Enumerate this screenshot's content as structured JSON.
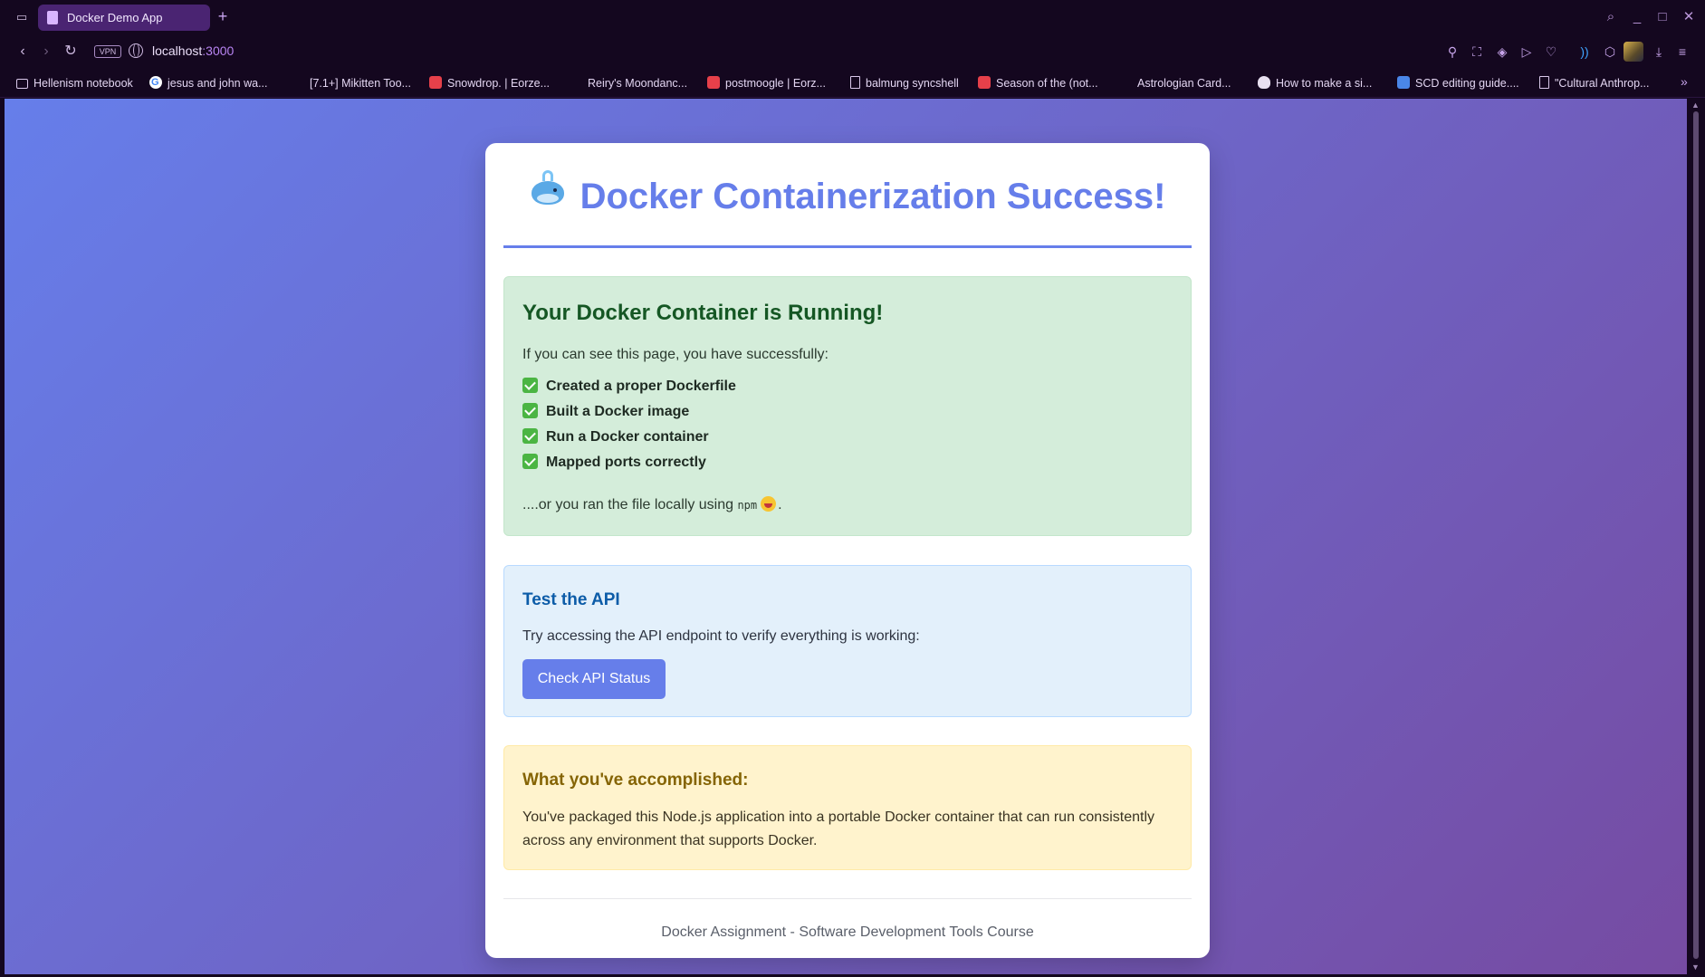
{
  "browser": {
    "tab_title": "Docker Demo App",
    "url_host": "localhost",
    "url_port": ":3000",
    "vpn_label": "VPN",
    "bookmarks": [
      {
        "label": "Hellenism notebook",
        "icon": "folder-icon"
      },
      {
        "label": "jesus and john wa...",
        "icon": "google-icon"
      },
      {
        "label": "[7.1+] Mikitten Too...",
        "icon": "none"
      },
      {
        "label": "Snowdrop. | Eorze...",
        "icon": "red-app-icon"
      },
      {
        "label": "Reiry's Moondanc...",
        "icon": "none"
      },
      {
        "label": "postmoogle | Eorz...",
        "icon": "red-app-icon"
      },
      {
        "label": "balmung syncshell",
        "icon": "document-icon"
      },
      {
        "label": "Season of the (not...",
        "icon": "red-app-icon"
      },
      {
        "label": "Astrologian Card...",
        "icon": "none"
      },
      {
        "label": "How to make a si...",
        "icon": "skull-icon"
      },
      {
        "label": "SCD editing guide....",
        "icon": "google-docs-icon"
      },
      {
        "label": "\"Cultural Anthrop...",
        "icon": "document-icon"
      }
    ]
  },
  "page": {
    "title": "Docker Containerization Success!",
    "title_icon": "whale-icon",
    "success": {
      "heading": "Your Docker Container is Running!",
      "intro": "If you can see this page, you have successfully:",
      "checklist": [
        "Created a proper Dockerfile",
        "Built a Docker image",
        "Run a Docker container",
        "Mapped ports correctly"
      ],
      "tail_before": "....or you ran the file locally using ",
      "tail_code": "npm",
      "tail_after": "."
    },
    "api": {
      "heading": "Test the API",
      "description": "Try accessing the API endpoint to verify everything is working:",
      "button_label": "Check API Status"
    },
    "accomplished": {
      "heading": "What you've accomplished:",
      "description": "You've packaged this Node.js application into a portable Docker container that can run consistently across any environment that supports Docker."
    },
    "footer": "Docker Assignment - Software Development Tools Course"
  },
  "colors": {
    "accent": "#667eea",
    "gradient_end": "#764ba2",
    "success_bg": "#d4edda",
    "info_bg": "#e3f0fb",
    "warn_bg": "#fff3cd"
  }
}
